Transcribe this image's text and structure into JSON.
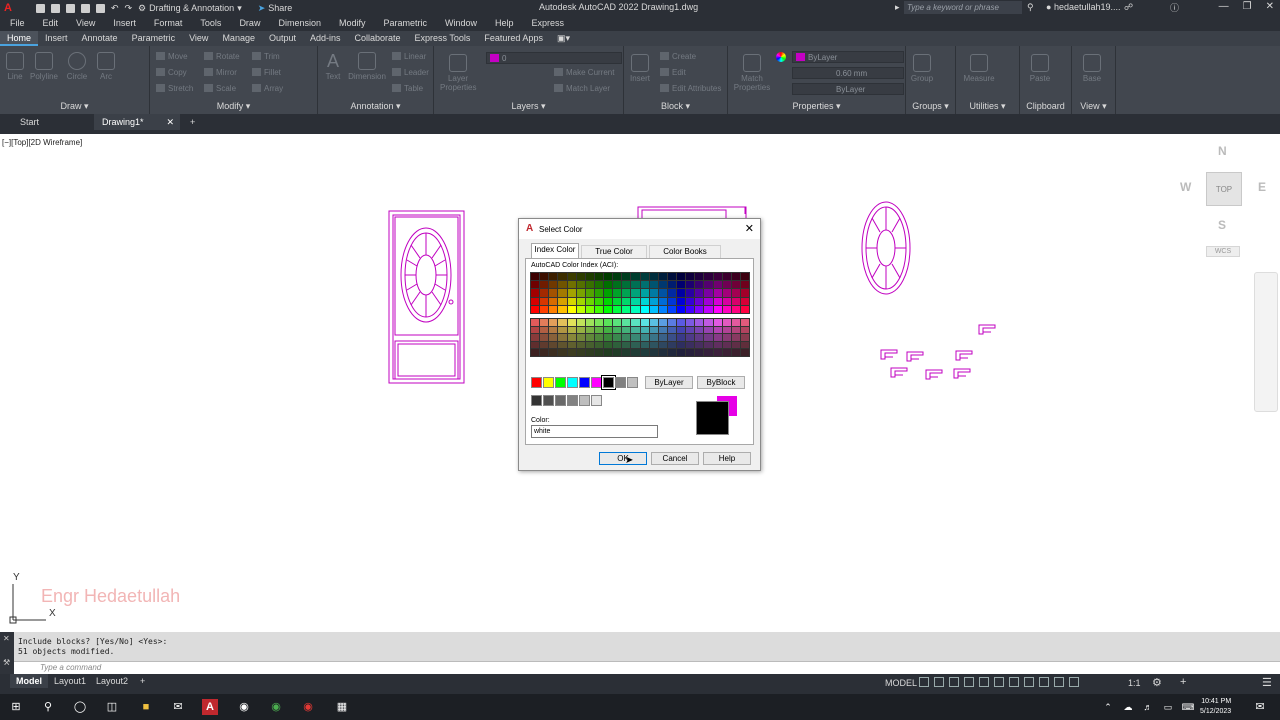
{
  "titlebar": {
    "workspace": "Drafting & Annotation",
    "share": "Share",
    "app_title": "Autodesk AutoCAD 2022   Drawing1.dwg",
    "search_placeholder": "Type a keyword or phrase",
    "user": "hedaetullah19...."
  },
  "menu": [
    "File",
    "Edit",
    "View",
    "Insert",
    "Format",
    "Tools",
    "Draw",
    "Dimension",
    "Modify",
    "Parametric",
    "Window",
    "Help",
    "Express"
  ],
  "ribbon_tabs": [
    "Home",
    "Insert",
    "Annotate",
    "Parametric",
    "View",
    "Manage",
    "Output",
    "Add-ins",
    "Collaborate",
    "Express Tools",
    "Featured Apps"
  ],
  "ribbon": {
    "draw": {
      "title": "Draw",
      "tools": [
        "Line",
        "Polyline",
        "Circle",
        "Arc"
      ]
    },
    "modify": {
      "title": "Modify",
      "tools": [
        "Move",
        "Rotate",
        "Trim",
        "Copy",
        "Mirror",
        "Fillet",
        "Stretch",
        "Scale",
        "Array"
      ]
    },
    "annotation": {
      "title": "Annotation",
      "tools": [
        "Text",
        "Dimension",
        "Linear",
        "Leader",
        "Table"
      ]
    },
    "layers": {
      "title": "Layers",
      "tools": [
        "Layer Properties",
        "Make Current",
        "Match Layer"
      ],
      "layer_value": "0"
    },
    "block": {
      "title": "Block",
      "tools": [
        "Insert",
        "Create",
        "Edit",
        "Edit Attributes"
      ]
    },
    "properties": {
      "title": "Properties",
      "tools": [
        "Match Properties"
      ],
      "color": "ByLayer",
      "lineweight": "0.60 mm",
      "linetype": "ByLayer"
    },
    "groups": {
      "title": "Groups",
      "tools": [
        "Group"
      ]
    },
    "utilities": {
      "title": "Utilities",
      "tools": [
        "Measure"
      ]
    },
    "clipboard": {
      "title": "Clipboard",
      "tools": [
        "Paste"
      ]
    },
    "view": {
      "title": "View",
      "tools": [
        "Base"
      ]
    }
  },
  "doc_tabs": [
    "Start",
    "Drawing1*"
  ],
  "viewport_label": "[−][Top][2D Wireframe]",
  "viewcube": {
    "n": "N",
    "s": "S",
    "e": "E",
    "w": "W",
    "top": "TOP",
    "wcs": "WCS"
  },
  "watermark": "Engr Hedaetullah",
  "ucs": {
    "x": "X",
    "y": "Y"
  },
  "dialog": {
    "title": "Select Color",
    "tabs": [
      "Index Color",
      "True Color",
      "Color Books"
    ],
    "aci_label": "AutoCAD Color Index (ACI):",
    "bylayer": "ByLayer",
    "byblock": "ByBlock",
    "color_label": "Color:",
    "color_value": "white",
    "ok": "OK",
    "cancel": "Cancel",
    "help": "Help"
  },
  "command": {
    "lines": [
      "Include blocks? [Yes/No] <Yes>:",
      "51 objects modified."
    ],
    "placeholder": "Type a command"
  },
  "status": {
    "tabs": [
      "Model",
      "Layout1",
      "Layout2"
    ],
    "model_label": "MODEL",
    "scale": "1:1"
  },
  "taskbar": {
    "time": "10:41 PM",
    "date": "5/12/2023"
  },
  "colors": {
    "accent": "#4aa3df",
    "magenta": "#c000c0",
    "dialog_bg": "#f0f0f0"
  }
}
